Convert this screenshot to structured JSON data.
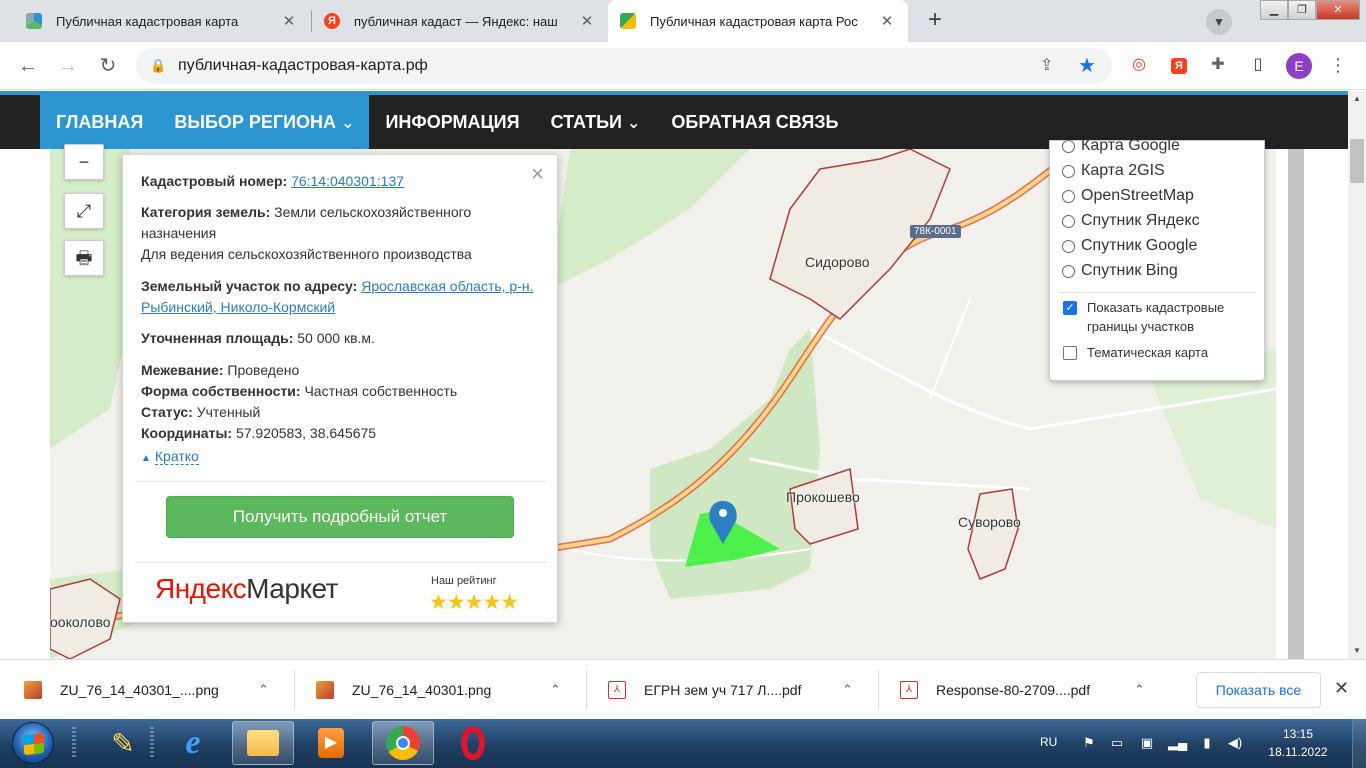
{
  "browser": {
    "tabs": [
      {
        "title": "Публичная кадастровая карта",
        "active": false
      },
      {
        "title": "публичная кадаст — Яндекс: наш",
        "active": false
      },
      {
        "title": "Публичная кадастровая карта Рос",
        "active": true
      }
    ],
    "url": "публичная-кадастровая-карта.рф",
    "profile_initial": "E",
    "extension_icons": [
      "target-icon",
      "yandex-icon",
      "puzzle-icon",
      "sidepanel-icon"
    ]
  },
  "site_nav": {
    "items": [
      "ГЛАВНАЯ",
      "ВЫБОР РЕГИОНА",
      "ИНФОРМАЦИЯ",
      "СТАТЬИ",
      "ОБРАТНАЯ СВЯЗЬ"
    ],
    "chevron": "⌄",
    "accent_color": "#2b96d1"
  },
  "map": {
    "labels": {
      "sidorovo": "Сидорово",
      "prokoshevo": "Прокошево",
      "suvorovo": "Суворово",
      "sokolovo": "ооколово"
    },
    "road_sign": "78К-0001",
    "controls": {
      "zoom_out": "−",
      "fullscreen": "⤢",
      "print": "🖶"
    }
  },
  "popup": {
    "close": "×",
    "cadastral_label": "Кадастровый номер:",
    "cadastral_value": "76:14:040301:137",
    "category_label": "Категория земель:",
    "category_value": "Земли сельскохозяйственного назначения",
    "usage": "Для ведения сельскохозяйственного производства",
    "address_label": "Земельный участок по адресу:",
    "address_value": "Ярославская область, р-н. Рыбинский, Николо-Кормский",
    "area_label": "Уточненная площадь:",
    "area_value": "50 000 кв.м.",
    "survey_label": "Межевание:",
    "survey_value": "Проведено",
    "ownership_label": "Форма собственности:",
    "ownership_value": "Частная собственность",
    "status_label": "Статус:",
    "status_value": "Учтенный",
    "coords_label": "Координаты:",
    "coords_value": "57.920583, 38.645675",
    "brief": "Кратко",
    "report_button": "Получить подробный отчет",
    "ym_ya": "Яндекс",
    "ym_market": "Маркет",
    "rating_label": "Наш рейтинг",
    "stars": "★★★★★"
  },
  "layers": {
    "options": [
      "Карта Google",
      "Карта 2GIS",
      "OpenStreetMap",
      "Спутник Яндекс",
      "Спутник Google",
      "Спутник Bing"
    ],
    "show_boundaries": "Показать кадастровые границы участков",
    "show_boundaries_checked": true,
    "thematic": "Тематическая карта",
    "thematic_checked": false
  },
  "downloads": {
    "items": [
      {
        "name": "ZU_76_14_40301_....png",
        "type": "png"
      },
      {
        "name": "ZU_76_14_40301.png",
        "type": "png"
      },
      {
        "name": "ЕГРН зем уч 717 Л....pdf",
        "type": "pdf"
      },
      {
        "name": "Response-80-2709....pdf",
        "type": "pdf"
      }
    ],
    "show_all": "Показать все"
  },
  "taskbar": {
    "lang": "RU",
    "time": "13:15",
    "date": "18.11.2022"
  }
}
